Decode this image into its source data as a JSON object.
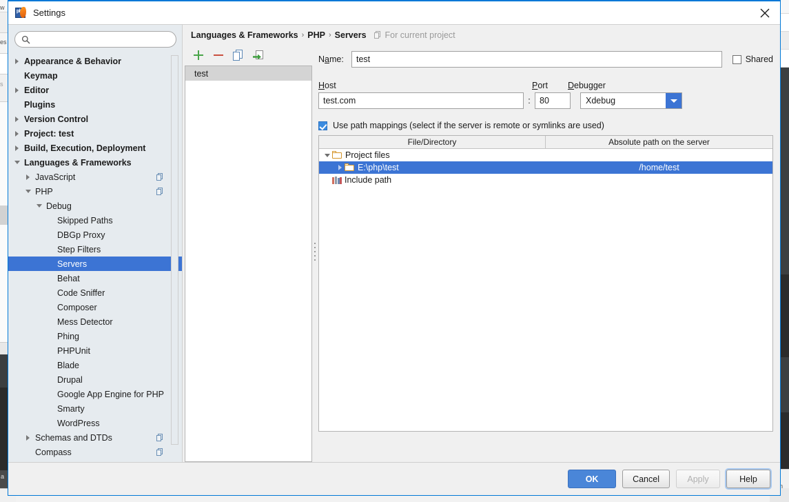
{
  "window": {
    "title": "Settings",
    "app_icon": "php-storm-icon",
    "close_icon": "close-icon"
  },
  "search": {
    "value": "",
    "placeholder": "",
    "icon": "search-icon"
  },
  "sidebar": {
    "scrollbar": "vertical-scrollbar",
    "items": [
      {
        "label": "Appearance & Behavior",
        "indent": 0,
        "arrow": "right",
        "bold": true,
        "selected": false,
        "copy": false
      },
      {
        "label": "Keymap",
        "indent": 0,
        "arrow": "none",
        "bold": true,
        "selected": false,
        "copy": false
      },
      {
        "label": "Editor",
        "indent": 0,
        "arrow": "right",
        "bold": true,
        "selected": false,
        "copy": false
      },
      {
        "label": "Plugins",
        "indent": 0,
        "arrow": "none",
        "bold": true,
        "selected": false,
        "copy": false
      },
      {
        "label": "Version Control",
        "indent": 0,
        "arrow": "right",
        "bold": true,
        "selected": false,
        "copy": false
      },
      {
        "label": "Project: test",
        "indent": 0,
        "arrow": "right",
        "bold": true,
        "selected": false,
        "copy": false
      },
      {
        "label": "Build, Execution, Deployment",
        "indent": 0,
        "arrow": "right",
        "bold": true,
        "selected": false,
        "copy": false
      },
      {
        "label": "Languages & Frameworks",
        "indent": 0,
        "arrow": "down",
        "bold": true,
        "selected": false,
        "copy": false
      },
      {
        "label": "JavaScript",
        "indent": 1,
        "arrow": "right",
        "bold": false,
        "selected": false,
        "copy": true
      },
      {
        "label": "PHP",
        "indent": 1,
        "arrow": "down",
        "bold": false,
        "selected": false,
        "copy": true
      },
      {
        "label": "Debug",
        "indent": 2,
        "arrow": "down",
        "bold": false,
        "selected": false,
        "copy": false
      },
      {
        "label": "Skipped Paths",
        "indent": 3,
        "arrow": "none",
        "bold": false,
        "selected": false,
        "copy": false
      },
      {
        "label": "DBGp Proxy",
        "indent": 3,
        "arrow": "none",
        "bold": false,
        "selected": false,
        "copy": false
      },
      {
        "label": "Step Filters",
        "indent": 3,
        "arrow": "none",
        "bold": false,
        "selected": false,
        "copy": false
      },
      {
        "label": "Servers",
        "indent": 3,
        "arrow": "none",
        "bold": false,
        "selected": true,
        "copy": false
      },
      {
        "label": "Behat",
        "indent": 3,
        "arrow": "none",
        "bold": false,
        "selected": false,
        "copy": false
      },
      {
        "label": "Code Sniffer",
        "indent": 3,
        "arrow": "none",
        "bold": false,
        "selected": false,
        "copy": false
      },
      {
        "label": "Composer",
        "indent": 3,
        "arrow": "none",
        "bold": false,
        "selected": false,
        "copy": false
      },
      {
        "label": "Mess Detector",
        "indent": 3,
        "arrow": "none",
        "bold": false,
        "selected": false,
        "copy": false
      },
      {
        "label": "Phing",
        "indent": 3,
        "arrow": "none",
        "bold": false,
        "selected": false,
        "copy": false
      },
      {
        "label": "PHPUnit",
        "indent": 3,
        "arrow": "none",
        "bold": false,
        "selected": false,
        "copy": false
      },
      {
        "label": "Blade",
        "indent": 3,
        "arrow": "none",
        "bold": false,
        "selected": false,
        "copy": false
      },
      {
        "label": "Drupal",
        "indent": 3,
        "arrow": "none",
        "bold": false,
        "selected": false,
        "copy": false
      },
      {
        "label": "Google App Engine for PHP",
        "indent": 3,
        "arrow": "none",
        "bold": false,
        "selected": false,
        "copy": false
      },
      {
        "label": "Smarty",
        "indent": 3,
        "arrow": "none",
        "bold": false,
        "selected": false,
        "copy": false
      },
      {
        "label": "WordPress",
        "indent": 3,
        "arrow": "none",
        "bold": false,
        "selected": false,
        "copy": false
      },
      {
        "label": "Schemas and DTDs",
        "indent": 1,
        "arrow": "right",
        "bold": false,
        "selected": false,
        "copy": true
      },
      {
        "label": "Compass",
        "indent": 1,
        "arrow": "none",
        "bold": false,
        "selected": false,
        "copy": true
      }
    ]
  },
  "breadcrumb": {
    "crumb1": "Languages & Frameworks",
    "crumb2": "PHP",
    "crumb3": "Servers",
    "separator": "›",
    "scope_label": "For current project",
    "scope_icon": "copy-icon"
  },
  "toolbar": {
    "add_icon": "plus-icon",
    "remove_icon": "minus-icon",
    "copy_icon": "copy-icon",
    "import_icon": "import-arrow-icon"
  },
  "server_list": {
    "items": [
      {
        "label": "test",
        "selected": true
      }
    ]
  },
  "splitter": {
    "name": "pane-splitter"
  },
  "form": {
    "name_label_pre": "N",
    "name_label_mnemonic": "a",
    "name_label_post": "me:",
    "name_value": "test",
    "shared_label": "Shared",
    "shared_checked": false,
    "host_label_mnemonic": "H",
    "host_label_post": "ost",
    "host_value": "test.com",
    "colon": ":",
    "port_label_mnemonic": "P",
    "port_label_post": "ort",
    "port_value": "80",
    "debugger_label_mnemonic": "D",
    "debugger_label_post": "ebugger",
    "debugger_value": "Xdebug",
    "debugger_dropdown_icon": "chevron-down-icon",
    "path_mappings_checked": true,
    "path_mappings_label": "Use path mappings (select if the server is remote or symlinks are used)"
  },
  "mapping_table": {
    "columns": [
      "File/Directory",
      "Absolute path on the server"
    ],
    "rows": [
      {
        "arrow": "down",
        "icon": "folder-icon",
        "file": "Project files",
        "server_path": "",
        "selected": false,
        "indent": 0
      },
      {
        "arrow": "right",
        "icon": "folder-icon",
        "file": "E:\\php\\test",
        "server_path": "/home/test",
        "selected": true,
        "indent": 1
      },
      {
        "arrow": "none",
        "icon": "books-icon",
        "file": "Include path",
        "server_path": "",
        "selected": false,
        "indent": 0
      }
    ]
  },
  "footer": {
    "ok": "OK",
    "cancel": "Cancel",
    "apply": "Apply",
    "help": "Help"
  },
  "colors": {
    "accent_blue": "#3c74d4",
    "primary_button": "#4a86d8",
    "selection_unfocused": "#d4d4d4",
    "sidebar_bg": "#e6ebef",
    "dialog_bg": "#f0f0f0",
    "add_green": "#4aa54a",
    "remove_red": "#c9503f",
    "folder_orange": "#d4952a"
  }
}
